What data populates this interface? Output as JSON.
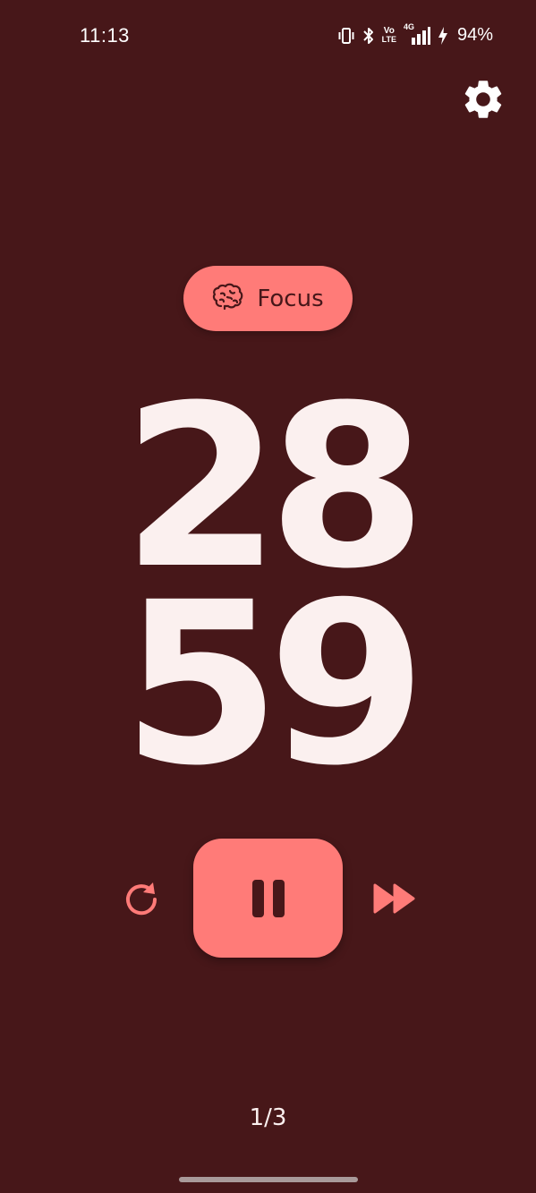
{
  "status_bar": {
    "time": "11:13",
    "icons": [
      "vibrate-icon",
      "bluetooth-icon",
      "volte-icon",
      "4g-signal-icon",
      "charging-icon"
    ],
    "volte_label_top": "Vo",
    "volte_label_bottom": "LTE",
    "network_label": "4G",
    "battery": "94%"
  },
  "header": {
    "settings_icon": "gear-icon"
  },
  "mode_chip": {
    "icon": "brain-icon",
    "label": "Focus"
  },
  "timer": {
    "minutes": "28",
    "seconds": "59"
  },
  "controls": {
    "reset_icon": "restart-icon",
    "pause_icon": "pause-icon",
    "skip_icon": "fast-forward-icon"
  },
  "session": {
    "counter": "1/3"
  },
  "colors": {
    "background": "#471719",
    "accent": "#ff7b78",
    "text": "#fbf0ef"
  }
}
